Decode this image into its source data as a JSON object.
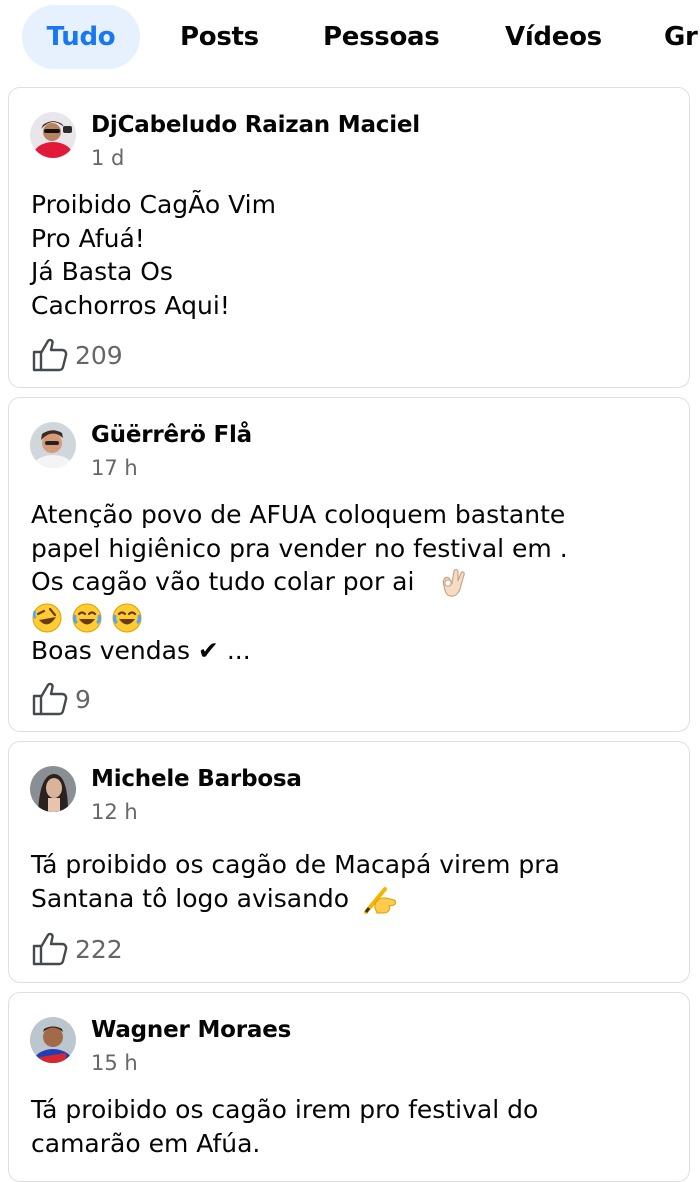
{
  "tabs": [
    {
      "label": "Tudo",
      "active": true
    },
    {
      "label": "Posts"
    },
    {
      "label": "Pessoas"
    },
    {
      "label": "Vídeos"
    },
    {
      "label": "Gr"
    }
  ],
  "posts": [
    {
      "author": "DjCabeludo Raizan Maciel",
      "time": "1 d",
      "lines": [
        "Proibido CagÃo Vim",
        "Pro Afuá!",
        "Já Basta Os",
        "Cachorros Aqui!"
      ],
      "likes": "209"
    },
    {
      "author": "Güërrêrö Flå",
      "time": "17 h",
      "lines": [
        "Atenção povo de AFUA coloquem bastante",
        "papel higiênico pra vender no festival em .",
        "Os cagão vão tudo colar por ai",
        "",
        "Boas vendas ✔ ..."
      ],
      "likes": "9"
    },
    {
      "author": "Michele Barbosa",
      "time": "12 h",
      "lines": [
        "Tá proibido os cagão de Macapá virem pra",
        "Santana tô logo avisando"
      ],
      "likes": "222"
    },
    {
      "author": "Wagner Moraes",
      "time": "15 h",
      "lines": [
        "Tá proibido os cagão irem pro festival do",
        "camarão em Afúa."
      ]
    }
  ],
  "icons": {
    "like": "thumbs-up-icon",
    "ok": "ok-hand-emoji",
    "laugh": "rofl-emoji",
    "joy": "joy-emoji",
    "write": "writing-hand-emoji"
  },
  "colors": {
    "accent": "#1877f2",
    "tab_active_bg": "#e7f0fd",
    "muted": "#65676b"
  }
}
